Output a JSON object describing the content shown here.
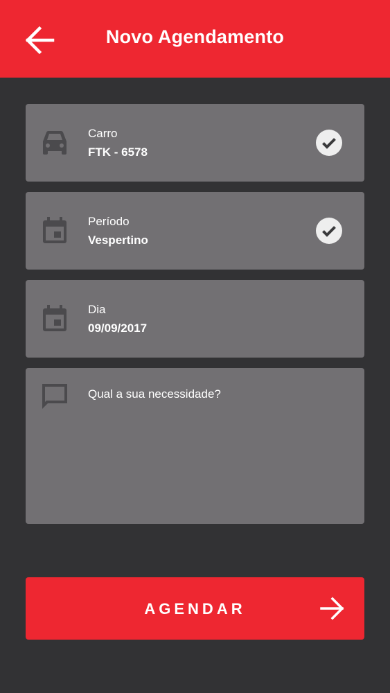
{
  "colors": {
    "accent": "#ee2731",
    "background": "#323234",
    "card": "#727073",
    "icon": "#4b4a4d",
    "check_fill": "#eeeeee",
    "check_mark": "#3a3a3c"
  },
  "header": {
    "title": "Novo Agendamento",
    "back_icon": "arrow-left-icon"
  },
  "form": {
    "car": {
      "icon": "car-icon",
      "label": "Carro",
      "value": "FTK - 6578",
      "status_icon": "check-circle-icon"
    },
    "period": {
      "icon": "calendar-icon",
      "label": "Período",
      "value": "Vespertino",
      "status_icon": "check-circle-icon"
    },
    "day": {
      "icon": "calendar-icon",
      "label": "Dia",
      "value": "09/09/2017"
    },
    "need": {
      "icon": "chat-bubble-icon",
      "placeholder": "Qual a sua necessidade?"
    }
  },
  "submit": {
    "label": "AGENDAR",
    "icon": "arrow-right-icon"
  }
}
